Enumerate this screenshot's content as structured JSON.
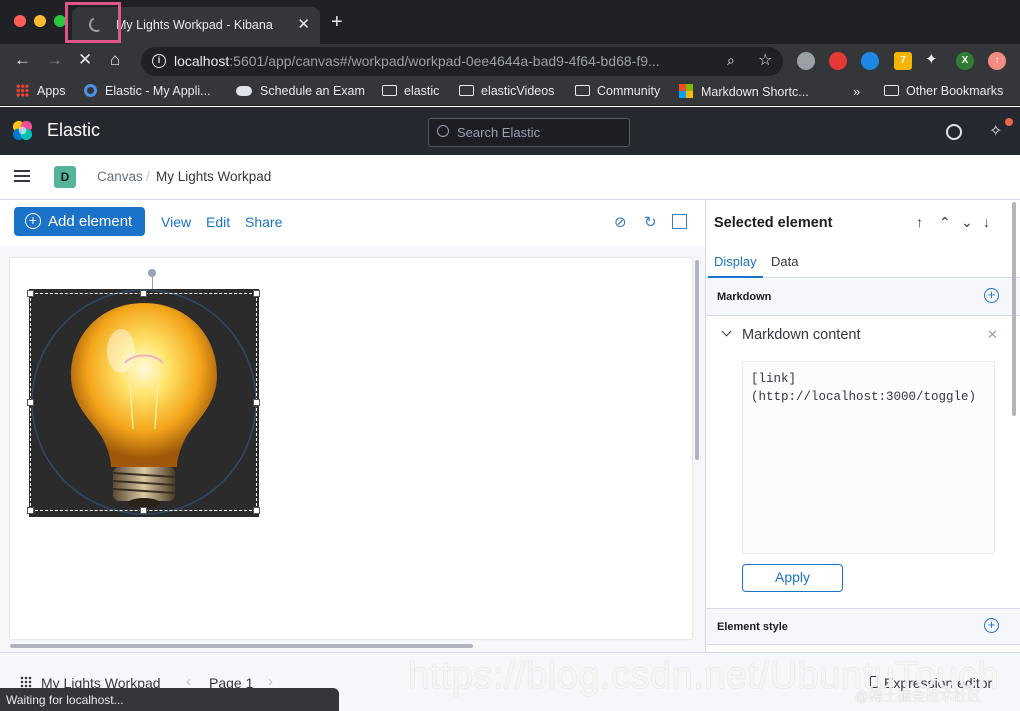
{
  "browser": {
    "tab_title": "My Lights Workpad - Kibana",
    "url_host": "localhost",
    "url_rest": ":5601/app/canvas#/workpad/workpad-0ee4644a-bad9-4f64-bd68-f9...",
    "status_text": "Waiting for localhost...",
    "bookmarks": [
      {
        "label": "Apps",
        "icon": "apps-grid-icon"
      },
      {
        "label": "Elastic - My Appli...",
        "icon": "elastic-icon"
      },
      {
        "label": "Schedule an Exam",
        "icon": "cloud-icon"
      },
      {
        "label": "elastic",
        "icon": "folder-icon"
      },
      {
        "label": "elasticVideos",
        "icon": "folder-icon"
      },
      {
        "label": "Community",
        "icon": "folder-icon"
      },
      {
        "label": "Markdown Shortc...",
        "icon": "microsoft-icon"
      },
      {
        "label": "Other Bookmarks",
        "icon": "folder-icon"
      }
    ],
    "extension_badge": "7",
    "profile_initial": "X"
  },
  "kibana": {
    "brand": "Elastic",
    "search_placeholder": "Search Elastic",
    "space_initial": "D",
    "breadcrumbs": [
      "Canvas",
      "My Lights Workpad"
    ]
  },
  "workpad_toolbar": {
    "add_element": "Add element",
    "view": "View",
    "edit": "Edit",
    "share": "Share"
  },
  "sidebar": {
    "title": "Selected element",
    "tabs": [
      "Display",
      "Data"
    ],
    "section_markdown": "Markdown",
    "markdown_content_title": "Markdown content",
    "markdown_value": "[link]\n(http://localhost:3000/toggle)",
    "apply": "Apply",
    "section_element_style": "Element style"
  },
  "footer": {
    "workpad_name": "My Lights Workpad",
    "page_label": "Page 1",
    "expression_editor": "Expression editor"
  },
  "watermark": {
    "url": "https://blog.csdn.net/UbuntuTouch",
    "credit": "@稀土掘金技术社区"
  },
  "colors": {
    "accent": "#1a73c8",
    "header_bg": "#25282f",
    "chrome_bg": "#35363a",
    "highlight": "#e0558a"
  }
}
